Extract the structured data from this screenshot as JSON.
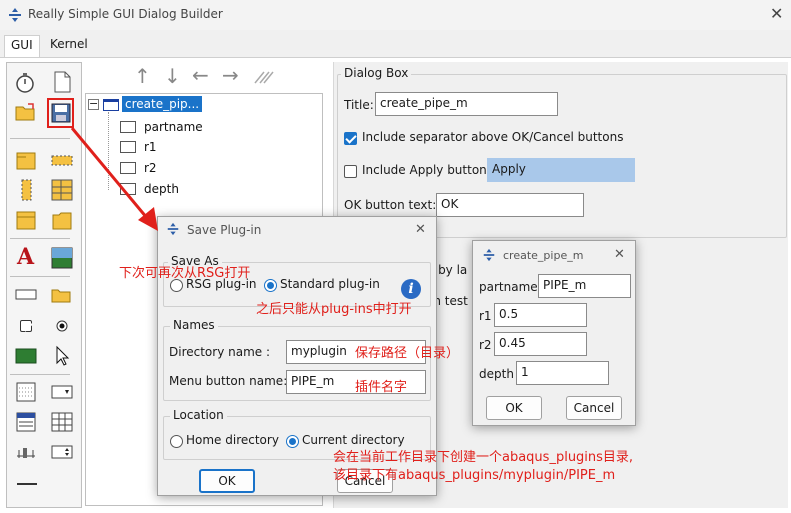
{
  "window": {
    "title": "Really Simple GUI Dialog Builder",
    "close_glyph": "✕"
  },
  "tabs": [
    {
      "label": "GUI"
    },
    {
      "label": "Kernel"
    }
  ],
  "tree": {
    "root": "create_pip...",
    "toggle": "−",
    "children": [
      "partname",
      "r1",
      "r2",
      "depth"
    ]
  },
  "tree_toolbar": {
    "up": "↑",
    "down": "↓",
    "left": "←",
    "right": "→"
  },
  "dialog_box": {
    "group_title": "Dialog Box",
    "title_label": "Title:",
    "title_value": "create_pipe_m",
    "separator_label": "Include separator above OK/Cancel buttons",
    "apply_label": "Include Apply button:",
    "apply_value": "Apply",
    "ok_text_label": "OK button text:",
    "ok_text_value": "OK",
    "partial_1": "s by la",
    "partial_2": "in test"
  },
  "save_plugin": {
    "title": "Save Plug-in",
    "close_glyph": "✕",
    "save_as": {
      "legend": "Save As",
      "rsg": "RSG plug-in",
      "standard": "Standard plug-in",
      "info_glyph": "i"
    },
    "names": {
      "legend": "Names",
      "dir_label": "Directory name :",
      "dir_value": "myplugin",
      "menu_label": "Menu button name:",
      "menu_value": "PIPE_m"
    },
    "location": {
      "legend": "Location",
      "home": "Home directory",
      "current": "Current directory"
    },
    "ok": "OK",
    "cancel": "Cancel"
  },
  "preview": {
    "title": "create_pipe_m",
    "close_glyph": "✕",
    "fields": [
      {
        "label": "partname",
        "value": "PIPE_m"
      },
      {
        "label": "r1",
        "value": "0.5"
      },
      {
        "label": "r2",
        "value": "0.45"
      },
      {
        "label": "depth",
        "value": "1"
      }
    ],
    "ok": "OK",
    "cancel": "Cancel"
  },
  "annotations": {
    "a1": "下次可再次从RSG打开",
    "a2": "之后只能从plug-ins中打开",
    "a3": "保存路径（目录）",
    "a4": "插件名字",
    "a5": "会在当前工作目录下创建一个abaqus_plugins目录,",
    "a6": "该目录下有abaqus_plugins/myplugin/PIPE_m"
  },
  "colors": {
    "accent": "#1a73c9",
    "annotation": "#e0201b",
    "apply_field": "#a9c8ea"
  }
}
